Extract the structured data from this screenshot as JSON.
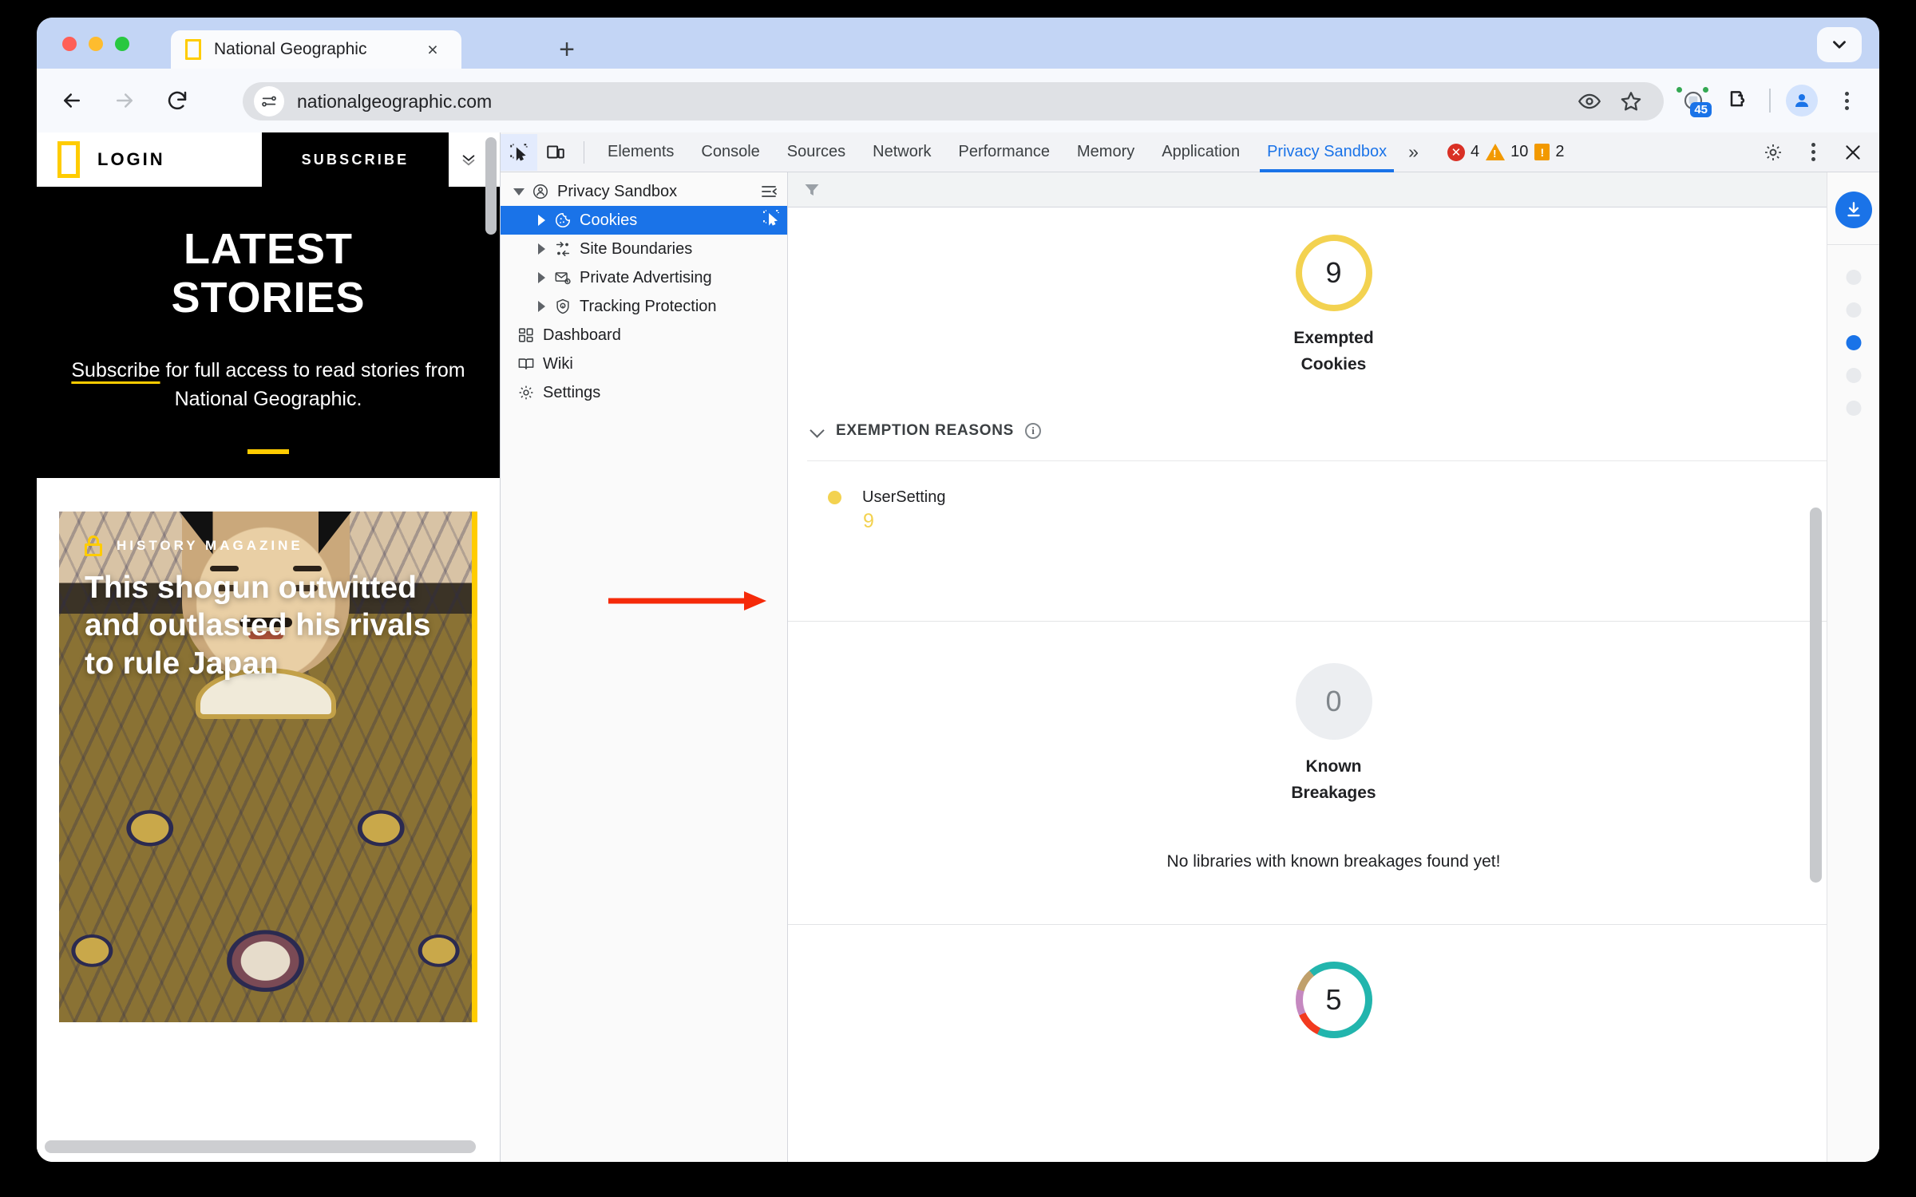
{
  "browser": {
    "tab": {
      "title": "National Geographic",
      "favicon": "ng-logo-icon",
      "close_label": "×"
    },
    "newtab_label": "+",
    "tabstrip_chevron": "chevron-down-icon",
    "nav": {
      "back": "back-arrow-icon",
      "forward": "forward-arrow-icon",
      "reload": "reload-icon"
    },
    "omnibox": {
      "url": "nationalgeographic.com",
      "site_info_icon": "tune-site-info-icon",
      "eye_icon": "eye-icon",
      "bookmark_icon": "star-icon"
    },
    "toolbar_right": {
      "extension_badge": "45",
      "puzzle_icon": "extensions-puzzle-icon",
      "profile_icon": "profile-avatar-icon",
      "menu_icon": "three-dot-menu-icon"
    }
  },
  "page": {
    "login_label": "LOGIN",
    "subscribe_label": "SUBSCRIBE",
    "hero_title_line1": "LATEST",
    "hero_title_line2": "STORIES",
    "hero_subscribe_link": "Subscribe",
    "hero_text_rest": " for full access to read stories from National Geographic.",
    "card_category": "HISTORY MAGAZINE",
    "card_title": "This shogun outwitted and outlasted his rivals to rule Japan",
    "accent_color": "#ffcc00"
  },
  "devtools": {
    "toolbar_icons": {
      "inspect": "inspect-element-icon",
      "device": "device-toolbar-icon"
    },
    "tabs": [
      {
        "label": "Elements",
        "active": false
      },
      {
        "label": "Console",
        "active": false
      },
      {
        "label": "Sources",
        "active": false
      },
      {
        "label": "Network",
        "active": false
      },
      {
        "label": "Performance",
        "active": false
      },
      {
        "label": "Memory",
        "active": false
      },
      {
        "label": "Application",
        "active": false
      },
      {
        "label": "Privacy Sandbox",
        "active": true
      }
    ],
    "more_tabs_label": "»",
    "status": {
      "errors": "4",
      "warnings": "10",
      "issues": "2"
    },
    "right_icons": {
      "settings": "gear-icon",
      "more": "three-dot-menu-icon",
      "close": "close-icon"
    },
    "sidebar": {
      "collapse_icon": "collapse-sidebar-icon",
      "inspect_icon": "inspect-element-icon",
      "items": [
        {
          "label": "Privacy Sandbox",
          "icon": "privacy-sandbox-icon",
          "arrow": "down",
          "depth": 0,
          "selected": false
        },
        {
          "label": "Cookies",
          "icon": "cookie-icon",
          "arrow": "right",
          "depth": 1,
          "selected": true
        },
        {
          "label": "Site Boundaries",
          "icon": "site-boundaries-icon",
          "arrow": "right",
          "depth": 1,
          "selected": false
        },
        {
          "label": "Private Advertising",
          "icon": "private-advertising-icon",
          "arrow": "right",
          "depth": 1,
          "selected": false
        },
        {
          "label": "Tracking Protection",
          "icon": "tracking-protection-icon",
          "arrow": "right",
          "depth": 1,
          "selected": false
        },
        {
          "label": "Dashboard",
          "icon": "dashboard-icon",
          "arrow": "none",
          "depth": 0,
          "selected": false
        },
        {
          "label": "Wiki",
          "icon": "wiki-book-icon",
          "arrow": "none",
          "depth": 0,
          "selected": false
        },
        {
          "label": "Settings",
          "icon": "gear-icon",
          "arrow": "none",
          "depth": 0,
          "selected": false
        }
      ]
    },
    "main": {
      "filter_icon": "filter-funnel-icon",
      "exempted": {
        "count": "9",
        "label_line1": "Exempted",
        "label_line2": "Cookies",
        "ring_color": "#f3d250"
      },
      "exemption_reasons": {
        "title": "EXEMPTION REASONS",
        "info_icon": "info-circle-icon",
        "chevron": "chevron-down-icon",
        "entries": [
          {
            "name": "UserSetting",
            "value": "9",
            "color": "#f3d250"
          }
        ]
      },
      "breakages": {
        "count": "0",
        "label_line1": "Known",
        "label_line2": "Breakages",
        "empty_message": "No libraries with known breakages found yet!"
      },
      "bottom_chart": {
        "count": "5",
        "segments": [
          {
            "color": "#22b5ad",
            "label": "teal"
          },
          {
            "color": "#f23a1f",
            "label": "red"
          },
          {
            "color": "#c588c0",
            "label": "purple"
          },
          {
            "color": "#c0a06b",
            "label": "tan"
          }
        ]
      }
    },
    "rail": {
      "download_icon": "download-icon",
      "dots": [
        {
          "active": false
        },
        {
          "active": false
        },
        {
          "active": true
        },
        {
          "active": false
        },
        {
          "active": false
        }
      ]
    }
  },
  "annotation": {
    "arrow": "red-pointer-arrow",
    "color": "#f52a09"
  }
}
